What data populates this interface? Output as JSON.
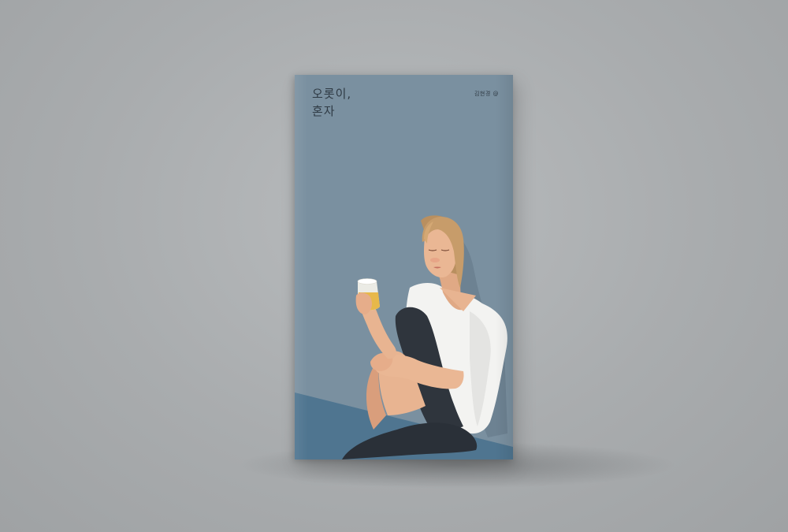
{
  "book": {
    "title_line1": "오롯이,",
    "title_line2": "혼자",
    "author": "김현경 @"
  },
  "colors": {
    "background": "#b0b3b5",
    "cover": "#7a90a0",
    "floor": "#4f7590",
    "hair": "#c19a6b",
    "shirt": "#f3f3f1",
    "pants": "#2f353d",
    "skin": "#e8b491",
    "drink": "#e7b84a"
  },
  "illustration": {
    "subject_icon": "woman-sitting-with-drink-icon"
  }
}
